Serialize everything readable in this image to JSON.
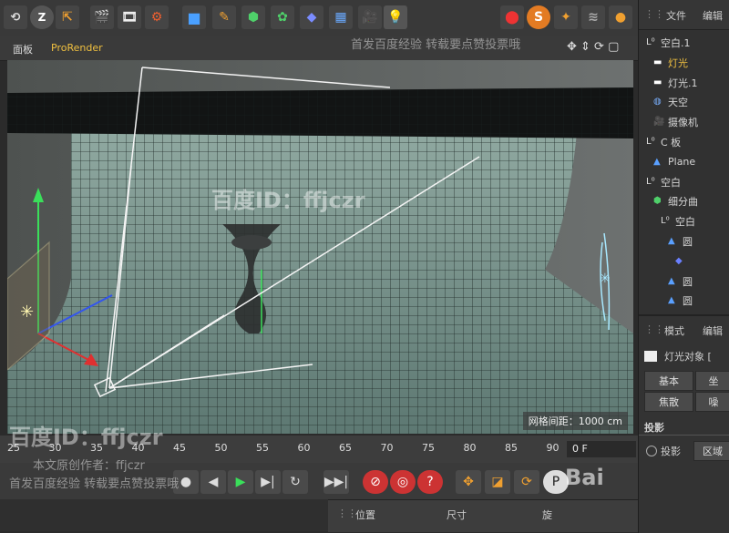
{
  "toolbar": {
    "icons": [
      "undo-icon",
      "redo-icon",
      "move-icon",
      "render-icon",
      "render-view-icon",
      "render-settings-icon",
      "cube-icon",
      "pen-icon",
      "subdivision-icon",
      "cloner-icon",
      "deformer-icon",
      "floor-icon",
      "camera-icon",
      "light-icon",
      "tag-icon",
      "sketch-icon",
      "effector-icon",
      "python-icon"
    ]
  },
  "viewport": {
    "menu_panel": "面板",
    "menu_prorender": "ProRender",
    "grid_label": "网格间距：1000 cm"
  },
  "timeline": {
    "ticks": [
      "25",
      "30",
      "35",
      "40",
      "45",
      "50",
      "55",
      "60",
      "65",
      "70",
      "75",
      "80",
      "85",
      "90"
    ],
    "frame_field": "0 F"
  },
  "coord": {
    "position": "位置",
    "size": "尺寸",
    "rotation": "旋"
  },
  "objects_header": {
    "file": "文件",
    "edit": "编辑"
  },
  "objects": [
    {
      "label": "空白.1",
      "icon": "null-icon",
      "indent": 0
    },
    {
      "label": "灯光",
      "icon": "light-icon",
      "indent": 1,
      "highlight": true
    },
    {
      "label": "灯光.1",
      "icon": "light-icon",
      "indent": 1
    },
    {
      "label": "天空",
      "icon": "sky-icon",
      "indent": 1
    },
    {
      "label": "摄像机",
      "icon": "camera-icon",
      "indent": 1
    },
    {
      "label": "C 板",
      "icon": "null-icon",
      "indent": 0
    },
    {
      "label": "Plane",
      "icon": "plane-icon",
      "indent": 1
    },
    {
      "label": "空白",
      "icon": "null-icon",
      "indent": 0
    },
    {
      "label": "细分曲",
      "icon": "subdivision-icon",
      "indent": 1
    },
    {
      "label": "空白",
      "icon": "null-icon",
      "indent": 2
    },
    {
      "label": "圆",
      "icon": "cone-icon",
      "indent": 3
    },
    {
      "label": "",
      "icon": "sphere-icon",
      "indent": 4
    },
    {
      "label": "圆",
      "icon": "cone-icon",
      "indent": 3
    },
    {
      "label": "圆",
      "icon": "cone-icon",
      "indent": 3
    }
  ],
  "attributes": {
    "mode": "模式",
    "edit": "编辑",
    "object_title": "灯光对象 [",
    "tab_basic": "基本",
    "tab_coord": "坐",
    "tab_focus": "焦散",
    "tab_noise": "噪",
    "section": "投影",
    "shadow_label": "投影",
    "area_label": "区域"
  },
  "watermarks": {
    "baidu_id": "百度ID：ffjczr",
    "author": "本文原创作者：ffjczr",
    "notice": "首发百度经验 转载要点赞投票哦",
    "logo": "Bai"
  }
}
